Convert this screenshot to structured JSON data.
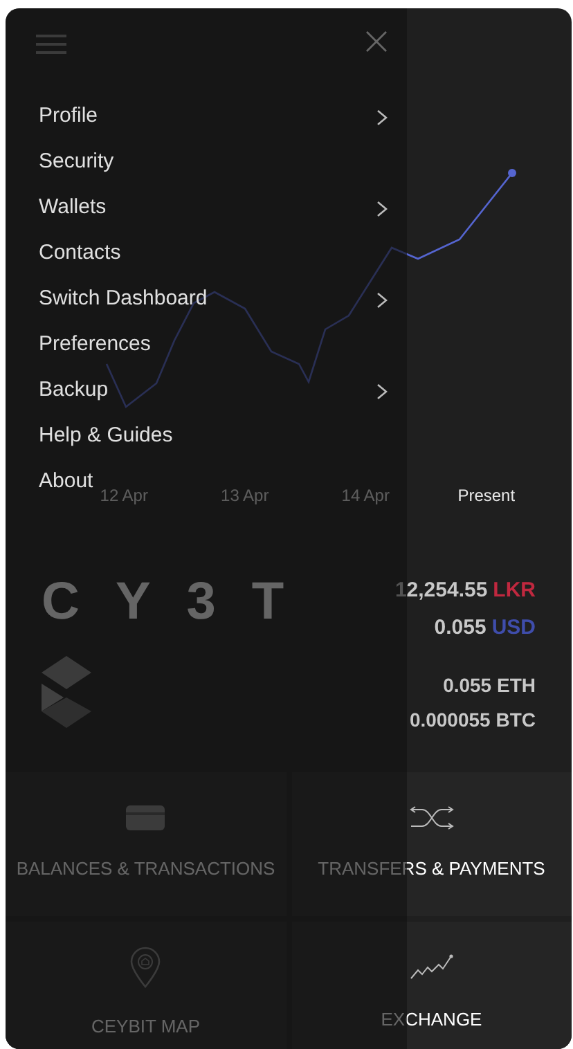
{
  "drawer": {
    "items": [
      {
        "label": "Profile",
        "has_submenu": true
      },
      {
        "label": "Security",
        "has_submenu": false
      },
      {
        "label": "Wallets",
        "has_submenu": true
      },
      {
        "label": "Contacts",
        "has_submenu": false
      },
      {
        "label": "Switch Dashboard",
        "has_submenu": true
      },
      {
        "label": "Preferences",
        "has_submenu": false
      },
      {
        "label": "Backup",
        "has_submenu": true
      },
      {
        "label": "Help & Guides",
        "has_submenu": false
      },
      {
        "label": "About",
        "has_submenu": false
      }
    ]
  },
  "chart": {
    "date_labels": [
      "12 Apr",
      "13 Apr",
      "14 Apr",
      "Present"
    ]
  },
  "logo": {
    "text": "CY3T"
  },
  "fiat_balances": [
    {
      "amount": "12,254.55",
      "currency": "LKR",
      "color": "#c0283f"
    },
    {
      "amount": "0.055",
      "currency": "USD",
      "color": "#3f4dab"
    }
  ],
  "crypto_balances": [
    "0.055 ETH",
    "0.000055 BTC"
  ],
  "tiles": [
    {
      "label": "BALANCES & TRANSACTIONS",
      "kind": "card"
    },
    {
      "label": "TRANSFERS & PAYMENTS",
      "kind": "transfer"
    },
    {
      "label": "CEYBIT MAP",
      "kind": "map"
    },
    {
      "label": "EXCHANGE",
      "kind": "exchange"
    }
  ]
}
